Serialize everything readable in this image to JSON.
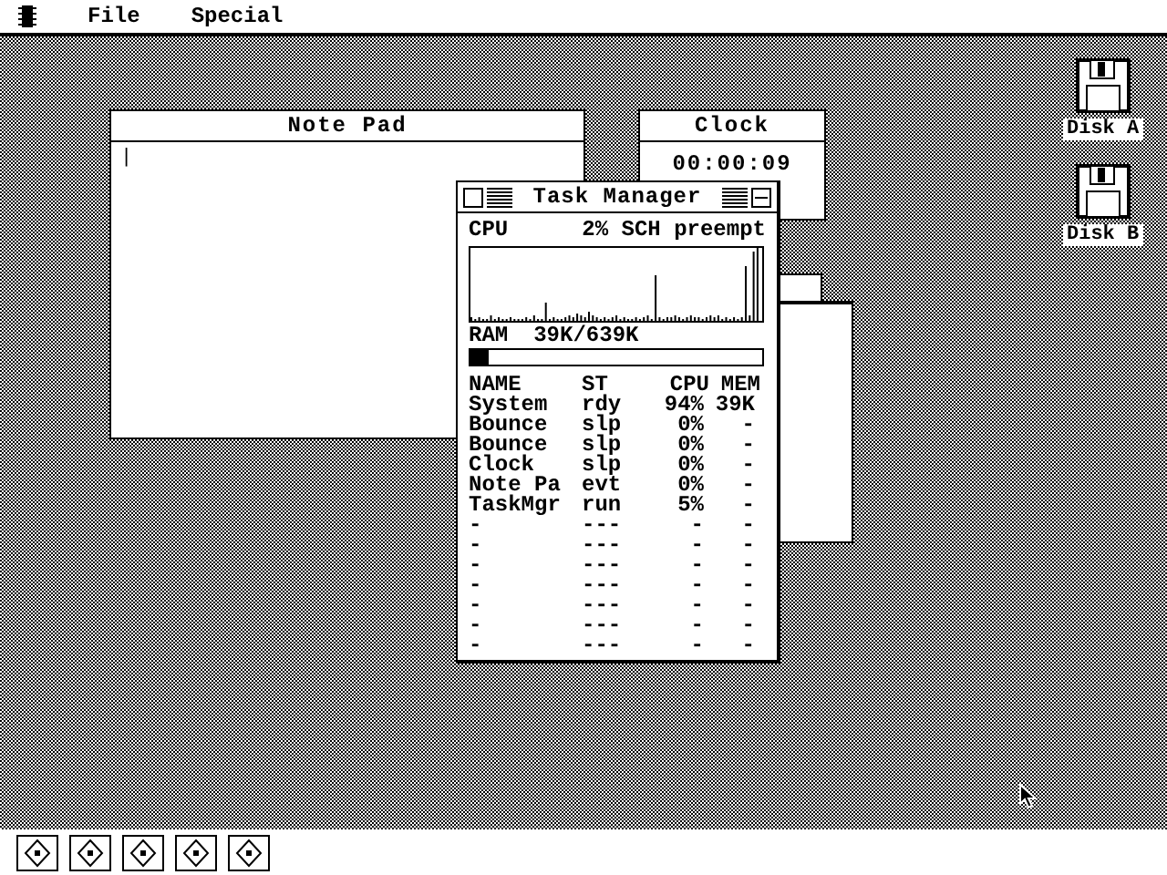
{
  "menu_bar": {
    "items": [
      "File",
      "Special"
    ]
  },
  "windows": [
    {
      "kind": "notepad",
      "title": "Note Pad",
      "content": "|"
    },
    {
      "kind": "clock",
      "title": "Clock",
      "time": "00:00:09"
    },
    {
      "kind": "blank"
    },
    {
      "kind": "blank"
    }
  ],
  "task_manager": {
    "title": "Task Manager",
    "cpu_label": "CPU",
    "cpu_reading": "2% SCH preempt",
    "ram_label": "RAM",
    "ram_reading": "39K/639K",
    "ram_bar": {
      "level": 0.06
    },
    "columns": [
      "NAME",
      "ST",
      "CPU",
      "MEM"
    ],
    "rows": [
      [
        "System",
        "rdy",
        "94%",
        "39K"
      ],
      [
        "Bounce",
        "slp",
        "0%",
        "-"
      ],
      [
        "Bounce",
        "slp",
        "0%",
        "-"
      ],
      [
        "Clock",
        "slp",
        "0%",
        "-"
      ],
      [
        "Note Pa",
        "evt",
        "0%",
        "-"
      ],
      [
        "TaskMgr",
        "run",
        "5%",
        "-"
      ],
      [
        "-",
        "---",
        "-",
        "-"
      ],
      [
        "-",
        "---",
        "-",
        "-"
      ],
      [
        "-",
        "---",
        "-",
        "-"
      ],
      [
        "-",
        "---",
        "-",
        "-"
      ],
      [
        "-",
        "---",
        "-",
        "-"
      ],
      [
        "-",
        "---",
        "-",
        "-"
      ],
      [
        "-",
        "---",
        "-",
        "-"
      ]
    ]
  },
  "drives": [
    {
      "label": "Disk A"
    },
    {
      "label": "Disk B"
    }
  ]
}
